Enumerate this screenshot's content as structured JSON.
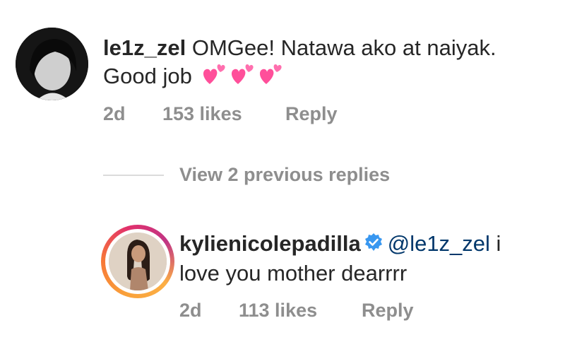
{
  "comment1": {
    "username": "le1z_zel",
    "text_line1": "OMGee! Natawa ako at naiyak.",
    "text_line2": "Good job",
    "emojis": [
      "two-hearts-icon",
      "two-hearts-icon",
      "two-hearts-icon"
    ],
    "time": "2d",
    "likes": "153 likes",
    "reply_label": "Reply"
  },
  "view_replies": "View 2 previous replies",
  "comment2": {
    "username": "kylienicolepadilla",
    "verified_icon": "verified-badge-icon",
    "mention": "@le1z_zel",
    "text_line1_end": " i",
    "text_line2": "love you mother dearrrr",
    "time": "2d",
    "likes": "113 likes",
    "reply_label": "Reply"
  },
  "colors": {
    "text": "#262626",
    "meta": "#8e8e8e",
    "mention": "#00376b",
    "verified": "#3897f0",
    "heart": "#ff4f9a"
  }
}
